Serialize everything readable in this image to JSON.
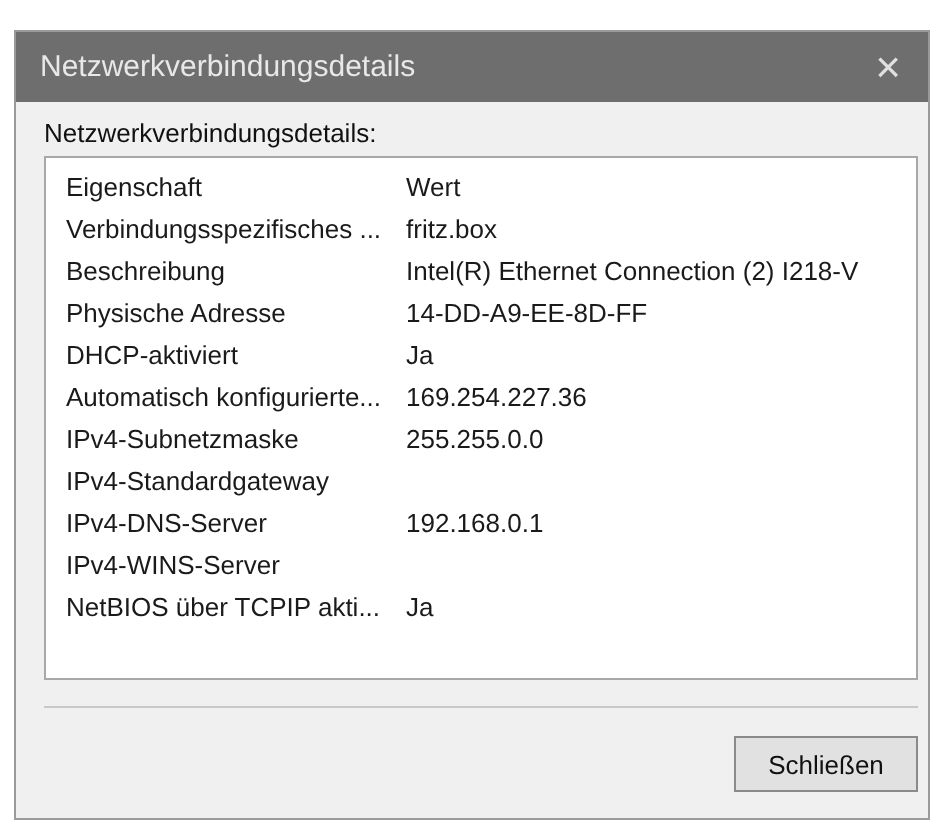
{
  "window": {
    "title": "Netzwerkverbindungsdetails",
    "close": "×"
  },
  "list_label": "Netzwerkverbindungsdetails:",
  "table": {
    "columns": [
      "Eigenschaft",
      "Wert"
    ],
    "rows": [
      [
        "Verbindungsspezifisches ...",
        "fritz.box"
      ],
      [
        "Beschreibung",
        "Intel(R) Ethernet Connection (2) I218-V"
      ],
      [
        "Physische Adresse",
        "14-DD-A9-EE-8D-FF"
      ],
      [
        "DHCP-aktiviert",
        "Ja"
      ],
      [
        "Automatisch konfigurierte...",
        "169.254.227.36"
      ],
      [
        "IPv4-Subnetzmaske",
        "255.255.0.0"
      ],
      [
        "IPv4-Standardgateway",
        ""
      ],
      [
        "IPv4-DNS-Server",
        "192.168.0.1"
      ],
      [
        "IPv4-WINS-Server",
        ""
      ],
      [
        "NetBIOS über TCPIP akti...",
        "Ja"
      ]
    ]
  },
  "buttons": [
    "Schließen"
  ]
}
